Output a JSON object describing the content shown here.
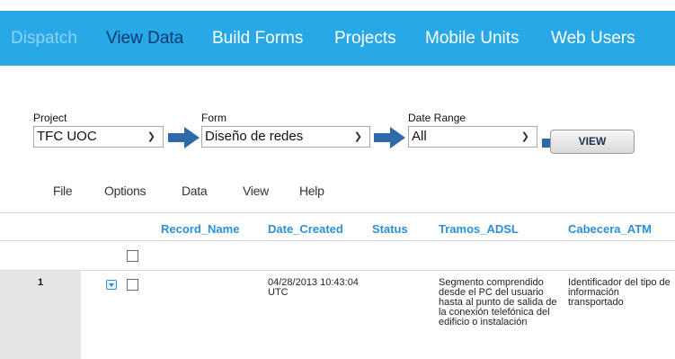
{
  "nav": {
    "items": [
      "Dispatch",
      "View Data",
      "Build Forms",
      "Projects",
      "Mobile Units",
      "Web Users"
    ]
  },
  "filters": {
    "project_label": "Project",
    "project_value": "TFC UOC",
    "form_label": "Form",
    "form_value": "Diseño de redes",
    "date_label": "Date Range",
    "date_value": "All",
    "view_button": "VIEW"
  },
  "menu": [
    "File",
    "Options",
    "Data",
    "View",
    "Help"
  ],
  "table": {
    "columns": [
      "Record_Name",
      "Date_Created",
      "Status",
      "Tramos_ADSL",
      "Cabecera_ATM"
    ],
    "rows": [
      {
        "num": "1",
        "record_name": "",
        "date_created": "04/28/2013 10:43:04 UTC",
        "status": "",
        "tramos_adsl": "Segmento comprendido desde el PC del usuario hasta al punto de salida de la conexión telefónica del edificio o instalación",
        "cabecera_atm": "Identificador del tipo de información transportado"
      }
    ]
  },
  "colors": {
    "nav_bg": "#29a8e8",
    "nav_active": "#0b3a6e",
    "header_link": "#2c8fd6",
    "arrow": "#2e6aa8"
  }
}
